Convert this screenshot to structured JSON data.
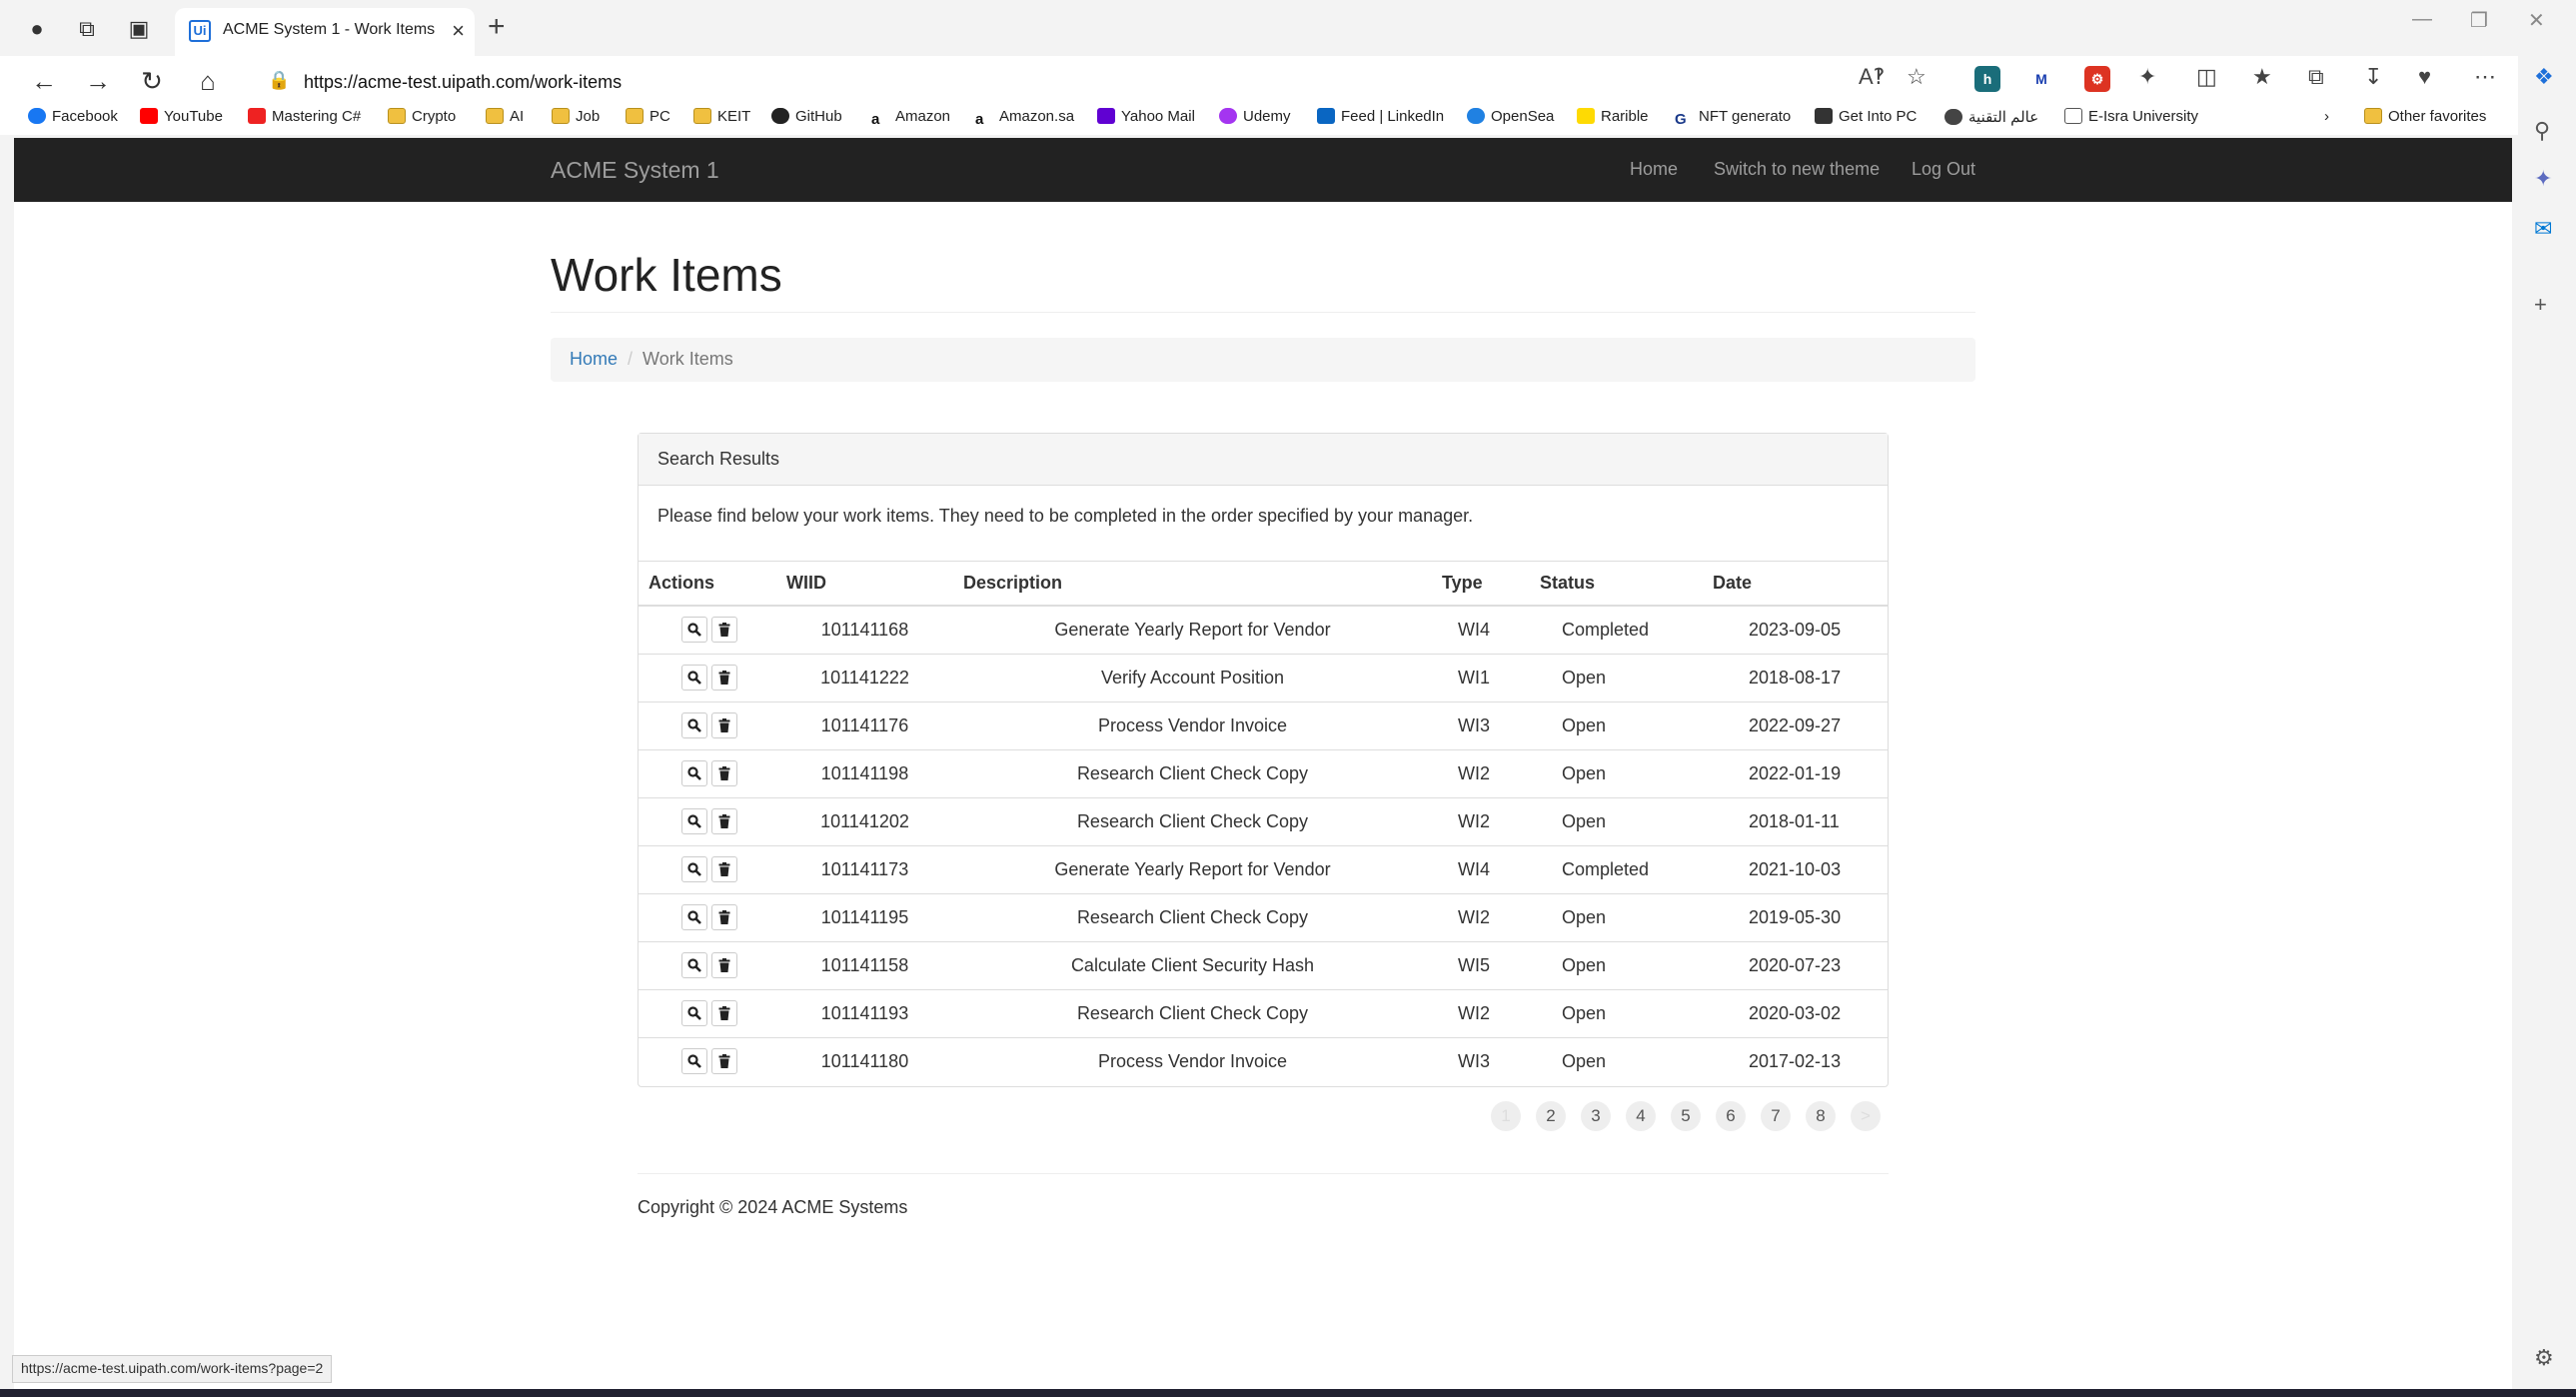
{
  "browser": {
    "tab_title": "ACME System 1 - Work Items",
    "favicon_text": "Ui",
    "url": "https://acme-test.uipath.com/work-items",
    "status_url": "https://acme-test.uipath.com/work-items?page=2",
    "bookmarks": [
      "Facebook",
      "YouTube",
      "Mastering C#",
      "Crypto",
      "AI",
      "Job",
      "PC",
      "KEIT",
      "GitHub",
      "Amazon",
      "Amazon.sa",
      "Yahoo Mail",
      "Udemy",
      "Feed | LinkedIn",
      "OpenSea",
      "Rarible",
      "NFT generato",
      "Get Into PC",
      "عالم التقنية",
      "E-Isra University"
    ],
    "other_favorites": "Other favorites"
  },
  "app": {
    "brand": "ACME System 1",
    "nav": {
      "home": "Home",
      "switch_theme": "Switch to new theme",
      "logout": "Log Out"
    },
    "page_title": "Work Items",
    "breadcrumb": {
      "home": "Home",
      "separator": "/",
      "current": "Work Items"
    },
    "panel": {
      "heading": "Search Results",
      "body": "Please find below your work items. They need to be completed in the order specified by your manager."
    },
    "table": {
      "headers": {
        "actions": "Actions",
        "wiid": "WIID",
        "description": "Description",
        "type": "Type",
        "status": "Status",
        "date": "Date"
      },
      "rows": [
        {
          "wiid": "101141168",
          "description": "Generate Yearly Report for Vendor",
          "type": "WI4",
          "status": "Completed",
          "date": "2023-09-05"
        },
        {
          "wiid": "101141222",
          "description": "Verify Account Position",
          "type": "WI1",
          "status": "Open",
          "date": "2018-08-17"
        },
        {
          "wiid": "101141176",
          "description": "Process Vendor Invoice",
          "type": "WI3",
          "status": "Open",
          "date": "2022-09-27"
        },
        {
          "wiid": "101141198",
          "description": "Research Client Check Copy",
          "type": "WI2",
          "status": "Open",
          "date": "2022-01-19"
        },
        {
          "wiid": "101141202",
          "description": "Research Client Check Copy",
          "type": "WI2",
          "status": "Open",
          "date": "2018-01-11"
        },
        {
          "wiid": "101141173",
          "description": "Generate Yearly Report for Vendor",
          "type": "WI4",
          "status": "Completed",
          "date": "2021-10-03"
        },
        {
          "wiid": "101141195",
          "description": "Research Client Check Copy",
          "type": "WI2",
          "status": "Open",
          "date": "2019-05-30"
        },
        {
          "wiid": "101141158",
          "description": "Calculate Client Security Hash",
          "type": "WI5",
          "status": "Open",
          "date": "2020-07-23"
        },
        {
          "wiid": "101141193",
          "description": "Research Client Check Copy",
          "type": "WI2",
          "status": "Open",
          "date": "2020-03-02"
        },
        {
          "wiid": "101141180",
          "description": "Process Vendor Invoice",
          "type": "WI3",
          "status": "Open",
          "date": "2017-02-13"
        }
      ]
    },
    "pagination": [
      "1",
      "2",
      "3",
      "4",
      "5",
      "6",
      "7",
      "8",
      ">"
    ],
    "current_page": "1",
    "copyright": "Copyright © 2024 ACME Systems"
  },
  "colors": {
    "navbar": "#222222",
    "link": "#337ab7",
    "accent": "#1e6fd9"
  }
}
